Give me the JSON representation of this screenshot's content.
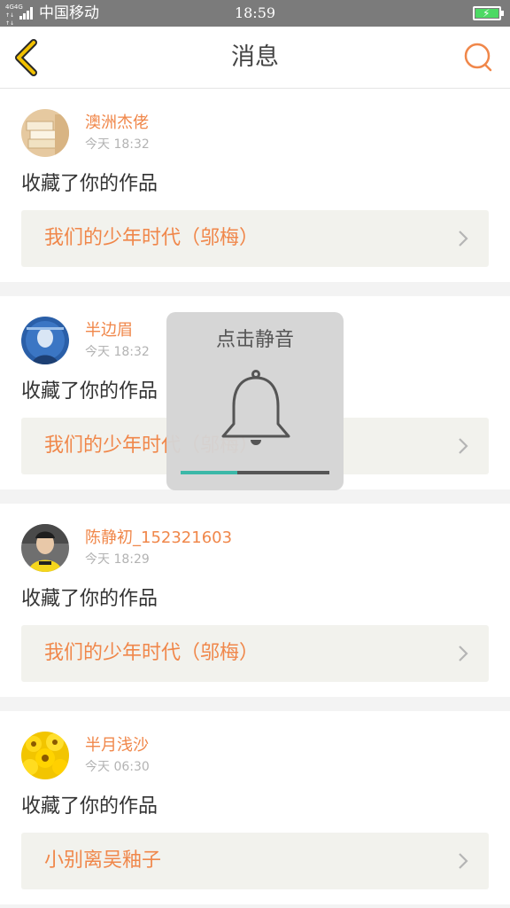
{
  "status_bar": {
    "network_top": "4G4G",
    "network_bottom": "↑↓ ↑↓",
    "carrier": "中国移动",
    "time": "18:59"
  },
  "header": {
    "title": "消息",
    "back_icon": "back-chevron-icon",
    "search_icon": "search-icon"
  },
  "colors": {
    "accent": "#f0874a",
    "back": "#f2c100",
    "volume_fill": "#3bb8a8"
  },
  "messages": [
    {
      "username": "澳洲杰佬",
      "time": "今天 18:32",
      "action": "收藏了你的作品",
      "work": "我们的少年时代（邬梅）",
      "avatar": "books"
    },
    {
      "username": "半边眉",
      "time": "今天 18:32",
      "action": "收藏了你的作品",
      "work": "我们的少年时代（邬梅）",
      "avatar": "blue-portrait"
    },
    {
      "username": "陈静初_152321603",
      "time": "今天 18:29",
      "action": "收藏了你的作品",
      "work": "我们的少年时代（邬梅）",
      "avatar": "boy-yellow-shirt"
    },
    {
      "username": "半月浅沙",
      "time": "今天 06:30",
      "action": "收藏了你的作品",
      "work": "小别离吴釉子",
      "avatar": "sunflowers"
    }
  ],
  "mute_toast": {
    "label": "点击静音",
    "icon": "bell-icon",
    "volume_level": 0.38
  }
}
